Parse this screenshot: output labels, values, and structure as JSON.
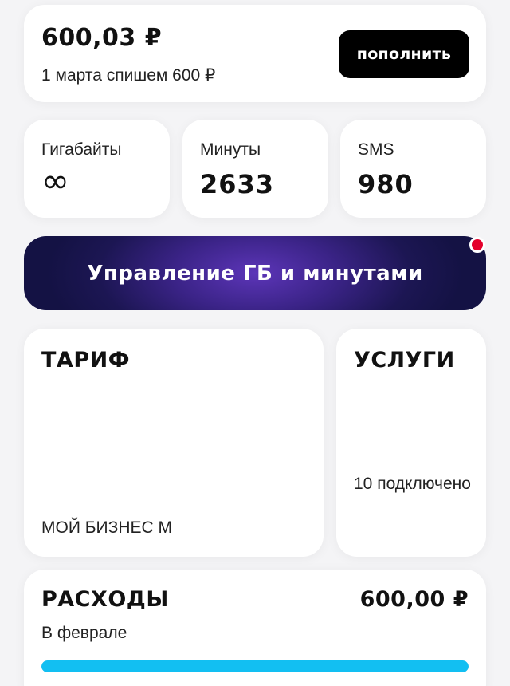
{
  "balance": {
    "amount": "600,03 ₽",
    "note": "1 марта спишем 600 ₽",
    "topup_label": "пополнить"
  },
  "counters": [
    {
      "label": "Гигабайты",
      "value": "∞",
      "icon": "infinity-icon"
    },
    {
      "label": "Минуты",
      "value": "2633"
    },
    {
      "label": "SMS",
      "value": "980"
    }
  ],
  "manage": {
    "label": "Управление ГБ и минутами",
    "has_notification": true,
    "notification_color": "#e4002b"
  },
  "tariff": {
    "title": "ТАРИФ",
    "name": "МОЙ БИЗНЕС М"
  },
  "services": {
    "title": "УСЛУГИ",
    "count_text": "10 подключено"
  },
  "expenses": {
    "title": "РАСХОДЫ",
    "amount": "600,00 ₽",
    "period": "В феврале",
    "progress": 1.0,
    "bar_color": "#12bff2"
  }
}
